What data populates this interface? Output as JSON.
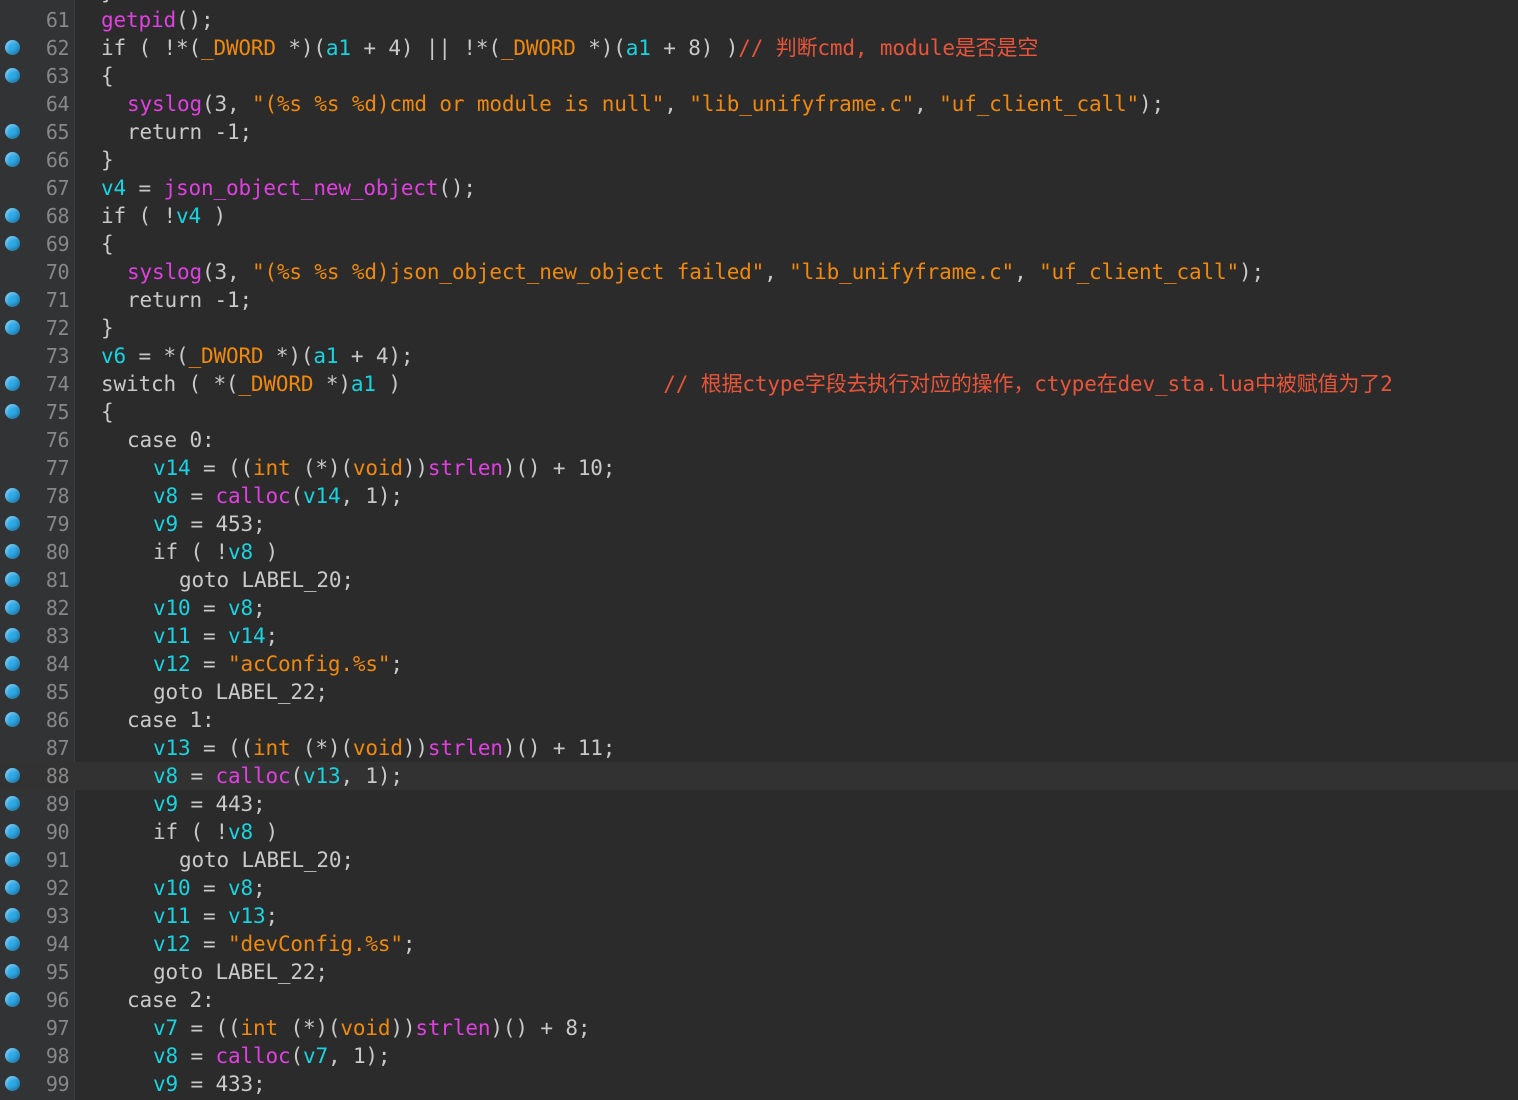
{
  "editor": {
    "top_fragment": "}",
    "lines": [
      {
        "n": "61",
        "bp": false,
        "current": false,
        "indent": 0,
        "tokens": [
          {
            "t": "getpid",
            "c": "func"
          },
          {
            "t": "();",
            "c": "plain"
          }
        ]
      },
      {
        "n": "62",
        "bp": true,
        "current": false,
        "indent": 0,
        "tokens": [
          {
            "t": "if ( !*(",
            "c": "plain"
          },
          {
            "t": "_DWORD",
            "c": "type"
          },
          {
            "t": " *)(",
            "c": "plain"
          },
          {
            "t": "a1",
            "c": "var"
          },
          {
            "t": " + 4) || !*(",
            "c": "plain"
          },
          {
            "t": "_DWORD",
            "c": "type"
          },
          {
            "t": " *)(",
            "c": "plain"
          },
          {
            "t": "a1",
            "c": "var"
          },
          {
            "t": " + 8) )",
            "c": "plain"
          },
          {
            "t": "// 判断cmd, module是否是空",
            "c": "cmt"
          }
        ]
      },
      {
        "n": "63",
        "bp": true,
        "current": false,
        "indent": 0,
        "tokens": [
          {
            "t": "{",
            "c": "plain"
          }
        ]
      },
      {
        "n": "64",
        "bp": false,
        "current": false,
        "indent": 1,
        "tokens": [
          {
            "t": "syslog",
            "c": "func"
          },
          {
            "t": "(3, ",
            "c": "plain"
          },
          {
            "t": "\"(%s %s %d)cmd or module is null\"",
            "c": "str"
          },
          {
            "t": ", ",
            "c": "plain"
          },
          {
            "t": "\"lib_unifyframe.c\"",
            "c": "str"
          },
          {
            "t": ", ",
            "c": "plain"
          },
          {
            "t": "\"uf_client_call\"",
            "c": "str"
          },
          {
            "t": ");",
            "c": "plain"
          }
        ]
      },
      {
        "n": "65",
        "bp": true,
        "current": false,
        "indent": 1,
        "tokens": [
          {
            "t": "return -1;",
            "c": "plain"
          }
        ]
      },
      {
        "n": "66",
        "bp": true,
        "current": false,
        "indent": 0,
        "tokens": [
          {
            "t": "}",
            "c": "plain"
          }
        ]
      },
      {
        "n": "67",
        "bp": false,
        "current": false,
        "indent": 0,
        "tokens": [
          {
            "t": "v4",
            "c": "var"
          },
          {
            "t": " = ",
            "c": "plain"
          },
          {
            "t": "json_object_new_object",
            "c": "func"
          },
          {
            "t": "();",
            "c": "plain"
          }
        ]
      },
      {
        "n": "68",
        "bp": true,
        "current": false,
        "indent": 0,
        "tokens": [
          {
            "t": "if ( !",
            "c": "plain"
          },
          {
            "t": "v4",
            "c": "var"
          },
          {
            "t": " )",
            "c": "plain"
          }
        ]
      },
      {
        "n": "69",
        "bp": true,
        "current": false,
        "indent": 0,
        "tokens": [
          {
            "t": "{",
            "c": "plain"
          }
        ]
      },
      {
        "n": "70",
        "bp": false,
        "current": false,
        "indent": 1,
        "tokens": [
          {
            "t": "syslog",
            "c": "func"
          },
          {
            "t": "(3, ",
            "c": "plain"
          },
          {
            "t": "\"(%s %s %d)json_object_new_object failed\"",
            "c": "str"
          },
          {
            "t": ", ",
            "c": "plain"
          },
          {
            "t": "\"lib_unifyframe.c\"",
            "c": "str"
          },
          {
            "t": ", ",
            "c": "plain"
          },
          {
            "t": "\"uf_client_call\"",
            "c": "str"
          },
          {
            "t": ");",
            "c": "plain"
          }
        ]
      },
      {
        "n": "71",
        "bp": true,
        "current": false,
        "indent": 1,
        "tokens": [
          {
            "t": "return -1;",
            "c": "plain"
          }
        ]
      },
      {
        "n": "72",
        "bp": true,
        "current": false,
        "indent": 0,
        "tokens": [
          {
            "t": "}",
            "c": "plain"
          }
        ]
      },
      {
        "n": "73",
        "bp": false,
        "current": false,
        "indent": 0,
        "tokens": [
          {
            "t": "v6",
            "c": "var"
          },
          {
            "t": " = *(",
            "c": "plain"
          },
          {
            "t": "_DWORD",
            "c": "type"
          },
          {
            "t": " *)(",
            "c": "plain"
          },
          {
            "t": "a1",
            "c": "var"
          },
          {
            "t": " + 4);",
            "c": "plain"
          }
        ]
      },
      {
        "n": "74",
        "bp": true,
        "current": false,
        "indent": 0,
        "tokens": [
          {
            "t": "switch ( *(",
            "c": "plain"
          },
          {
            "t": "_DWORD",
            "c": "type"
          },
          {
            "t": " *)",
            "c": "plain"
          },
          {
            "t": "a1",
            "c": "var"
          },
          {
            "t": " )                     ",
            "c": "plain"
          },
          {
            "t": "// 根据ctype字段去执行对应的操作，ctype在dev_sta.lua中被赋值为了2",
            "c": "cmt"
          }
        ]
      },
      {
        "n": "75",
        "bp": true,
        "current": false,
        "indent": 0,
        "tokens": [
          {
            "t": "{",
            "c": "plain"
          }
        ]
      },
      {
        "n": "76",
        "bp": false,
        "current": false,
        "indent": 1,
        "tokens": [
          {
            "t": "case 0:",
            "c": "plain"
          }
        ]
      },
      {
        "n": "77",
        "bp": false,
        "current": false,
        "indent": 2,
        "tokens": [
          {
            "t": "v14",
            "c": "var"
          },
          {
            "t": " = ((",
            "c": "plain"
          },
          {
            "t": "int",
            "c": "type"
          },
          {
            "t": " (*)(",
            "c": "plain"
          },
          {
            "t": "void",
            "c": "type"
          },
          {
            "t": "))",
            "c": "plain"
          },
          {
            "t": "strlen",
            "c": "func"
          },
          {
            "t": ")() + 10;",
            "c": "plain"
          }
        ]
      },
      {
        "n": "78",
        "bp": true,
        "current": false,
        "indent": 2,
        "tokens": [
          {
            "t": "v8",
            "c": "var"
          },
          {
            "t": " = ",
            "c": "plain"
          },
          {
            "t": "calloc",
            "c": "func"
          },
          {
            "t": "(",
            "c": "plain"
          },
          {
            "t": "v14",
            "c": "var"
          },
          {
            "t": ", 1);",
            "c": "plain"
          }
        ]
      },
      {
        "n": "79",
        "bp": true,
        "current": false,
        "indent": 2,
        "tokens": [
          {
            "t": "v9",
            "c": "var"
          },
          {
            "t": " = 453;",
            "c": "plain"
          }
        ]
      },
      {
        "n": "80",
        "bp": true,
        "current": false,
        "indent": 2,
        "tokens": [
          {
            "t": "if ( !",
            "c": "plain"
          },
          {
            "t": "v8",
            "c": "var"
          },
          {
            "t": " )",
            "c": "plain"
          }
        ]
      },
      {
        "n": "81",
        "bp": true,
        "current": false,
        "indent": 3,
        "tokens": [
          {
            "t": "goto LABEL_20;",
            "c": "plain"
          }
        ]
      },
      {
        "n": "82",
        "bp": true,
        "current": false,
        "indent": 2,
        "tokens": [
          {
            "t": "v10",
            "c": "var"
          },
          {
            "t": " = ",
            "c": "plain"
          },
          {
            "t": "v8",
            "c": "var"
          },
          {
            "t": ";",
            "c": "plain"
          }
        ]
      },
      {
        "n": "83",
        "bp": true,
        "current": false,
        "indent": 2,
        "tokens": [
          {
            "t": "v11",
            "c": "var"
          },
          {
            "t": " = ",
            "c": "plain"
          },
          {
            "t": "v14",
            "c": "var"
          },
          {
            "t": ";",
            "c": "plain"
          }
        ]
      },
      {
        "n": "84",
        "bp": true,
        "current": false,
        "indent": 2,
        "tokens": [
          {
            "t": "v12",
            "c": "var"
          },
          {
            "t": " = ",
            "c": "plain"
          },
          {
            "t": "\"acConfig.%s\"",
            "c": "str"
          },
          {
            "t": ";",
            "c": "plain"
          }
        ]
      },
      {
        "n": "85",
        "bp": true,
        "current": false,
        "indent": 2,
        "tokens": [
          {
            "t": "goto LABEL_22;",
            "c": "plain"
          }
        ]
      },
      {
        "n": "86",
        "bp": true,
        "current": false,
        "indent": 1,
        "tokens": [
          {
            "t": "case 1:",
            "c": "plain"
          }
        ]
      },
      {
        "n": "87",
        "bp": false,
        "current": false,
        "indent": 2,
        "tokens": [
          {
            "t": "v13",
            "c": "var"
          },
          {
            "t": " = ((",
            "c": "plain"
          },
          {
            "t": "int",
            "c": "type"
          },
          {
            "t": " (*)(",
            "c": "plain"
          },
          {
            "t": "void",
            "c": "type"
          },
          {
            "t": "))",
            "c": "plain"
          },
          {
            "t": "strlen",
            "c": "func"
          },
          {
            "t": ")() + 11;",
            "c": "plain"
          }
        ]
      },
      {
        "n": "88",
        "bp": true,
        "current": true,
        "indent": 2,
        "tokens": [
          {
            "t": "v8",
            "c": "var"
          },
          {
            "t": " = ",
            "c": "plain"
          },
          {
            "t": "calloc",
            "c": "func"
          },
          {
            "t": "(",
            "c": "plain"
          },
          {
            "t": "v13",
            "c": "var"
          },
          {
            "t": ", 1);",
            "c": "plain"
          }
        ]
      },
      {
        "n": "89",
        "bp": true,
        "current": false,
        "indent": 2,
        "tokens": [
          {
            "t": "v9",
            "c": "var"
          },
          {
            "t": " = 443;",
            "c": "plain"
          }
        ]
      },
      {
        "n": "90",
        "bp": true,
        "current": false,
        "indent": 2,
        "tokens": [
          {
            "t": "if ( !",
            "c": "plain"
          },
          {
            "t": "v8",
            "c": "var"
          },
          {
            "t": " )",
            "c": "plain"
          }
        ]
      },
      {
        "n": "91",
        "bp": true,
        "current": false,
        "indent": 3,
        "tokens": [
          {
            "t": "goto LABEL_20;",
            "c": "plain"
          }
        ]
      },
      {
        "n": "92",
        "bp": true,
        "current": false,
        "indent": 2,
        "tokens": [
          {
            "t": "v10",
            "c": "var"
          },
          {
            "t": " = ",
            "c": "plain"
          },
          {
            "t": "v8",
            "c": "var"
          },
          {
            "t": ";",
            "c": "plain"
          }
        ]
      },
      {
        "n": "93",
        "bp": true,
        "current": false,
        "indent": 2,
        "tokens": [
          {
            "t": "v11",
            "c": "var"
          },
          {
            "t": " = ",
            "c": "plain"
          },
          {
            "t": "v13",
            "c": "var"
          },
          {
            "t": ";",
            "c": "plain"
          }
        ]
      },
      {
        "n": "94",
        "bp": true,
        "current": false,
        "indent": 2,
        "tokens": [
          {
            "t": "v12",
            "c": "var"
          },
          {
            "t": " = ",
            "c": "plain"
          },
          {
            "t": "\"devConfig.%s\"",
            "c": "str"
          },
          {
            "t": ";",
            "c": "plain"
          }
        ]
      },
      {
        "n": "95",
        "bp": true,
        "current": false,
        "indent": 2,
        "tokens": [
          {
            "t": "goto LABEL_22;",
            "c": "plain"
          }
        ]
      },
      {
        "n": "96",
        "bp": true,
        "current": false,
        "indent": 1,
        "tokens": [
          {
            "t": "case 2:",
            "c": "plain"
          }
        ]
      },
      {
        "n": "97",
        "bp": false,
        "current": false,
        "indent": 2,
        "tokens": [
          {
            "t": "v7",
            "c": "var"
          },
          {
            "t": " = ((",
            "c": "plain"
          },
          {
            "t": "int",
            "c": "type"
          },
          {
            "t": " (*)(",
            "c": "plain"
          },
          {
            "t": "void",
            "c": "type"
          },
          {
            "t": "))",
            "c": "plain"
          },
          {
            "t": "strlen",
            "c": "func"
          },
          {
            "t": ")() + 8;",
            "c": "plain"
          }
        ]
      },
      {
        "n": "98",
        "bp": true,
        "current": false,
        "indent": 2,
        "tokens": [
          {
            "t": "v8",
            "c": "var"
          },
          {
            "t": " = ",
            "c": "plain"
          },
          {
            "t": "calloc",
            "c": "func"
          },
          {
            "t": "(",
            "c": "plain"
          },
          {
            "t": "v7",
            "c": "var"
          },
          {
            "t": ", 1);",
            "c": "plain"
          }
        ]
      },
      {
        "n": "99",
        "bp": true,
        "current": false,
        "indent": 2,
        "tokens": [
          {
            "t": "v9",
            "c": "var"
          },
          {
            "t": " = 433;",
            "c": "plain"
          }
        ]
      }
    ]
  },
  "colors": {
    "background": "#2b2b2b",
    "line_number": "#888888",
    "plain": "#c9c9c9",
    "function": "#e040e0",
    "variable": "#19d3e0",
    "string": "#f0890c",
    "comment": "#e8553a",
    "breakpoint": "#2ea8e6"
  }
}
